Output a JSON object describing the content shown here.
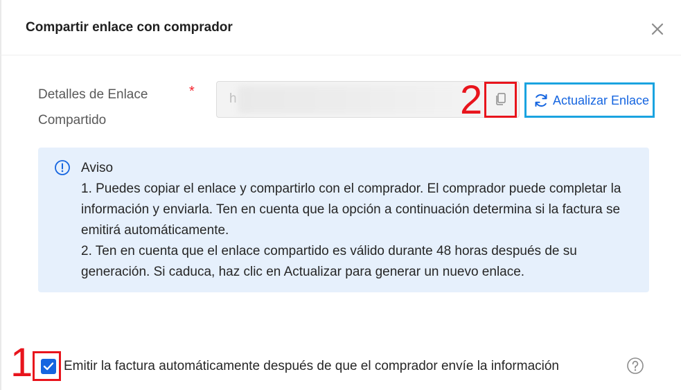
{
  "dialog": {
    "title": "Compartir enlace con comprador"
  },
  "form": {
    "link_label": "Detalles de Enlace Compartido",
    "required_mark": "*",
    "link_value_prefix": "h",
    "refresh_label": "Actualizar Enlace"
  },
  "notice": {
    "title": "Aviso",
    "line1": "1. Puedes copiar el enlace y compartirlo con el comprador. El comprador puede completar la información y enviarla. Ten en cuenta que la opción a continuación determina si la factura se emitirá automáticamente.",
    "line2": "2. Ten en cuenta que el enlace compartido es válido durante 48 horas después de su generación. Si caduca, haz clic en Actualizar para generar un nuevo enlace."
  },
  "auto_issue": {
    "label": "Emitir la factura automáticamente después de que el comprador envíe la información",
    "checked": true
  },
  "annotations": {
    "step1": "1",
    "step2": "2",
    "color": "#e8141c",
    "refresh_highlight_color": "#1aa3e0"
  },
  "colors": {
    "primary": "#1565e0",
    "notice_bg": "#e6f0fc",
    "required": "#f5222d"
  },
  "icons": {
    "close": "close-icon",
    "copy": "copy-icon",
    "refresh": "refresh-icon",
    "info": "info-circle-icon",
    "help": "question-circle-icon",
    "check": "checkmark-icon"
  }
}
